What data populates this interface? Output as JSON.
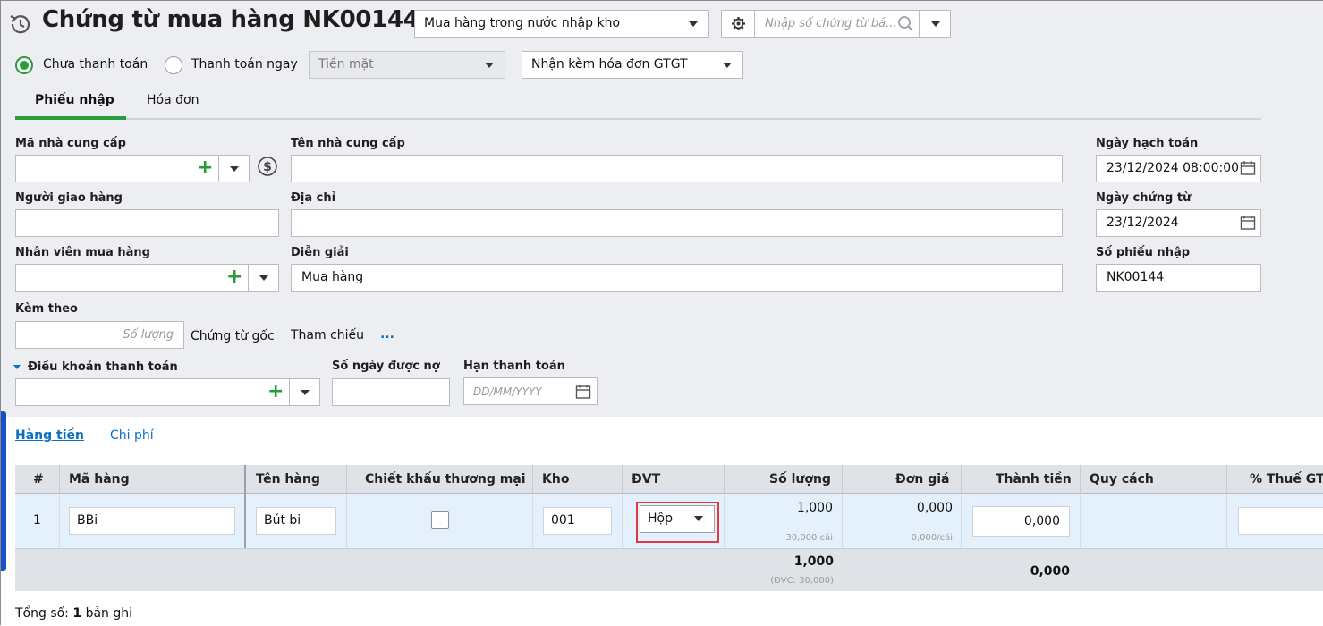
{
  "header": {
    "title": "Chứng từ mua hàng NK00144",
    "voucher_type": "Mua hàng trong nước nhập kho",
    "search_placeholder": "Nhập số chứng từ bá..."
  },
  "payment": {
    "unpaid_label": "Chưa thanh toán",
    "paid_now_label": "Thanh toán ngay",
    "method": "Tiền mặt",
    "invoice_option": "Nhận kèm hóa đơn GTGT"
  },
  "tabs": [
    "Phiếu nhập",
    "Hóa đơn"
  ],
  "form": {
    "supplier_code_label": "Mã nhà cung cấp",
    "supplier_name_label": "Tên nhà cung cấp",
    "deliverer_label": "Người giao hàng",
    "address_label": "Địa chỉ",
    "buyer_label": "Nhân viên mua hàng",
    "description_label": "Diễn giải",
    "description_value": "Mua hàng",
    "attach_label": "Kèm theo",
    "attach_placeholder": "Số lượng",
    "original_doc_label": "Chứng từ gốc",
    "reference_label": "Tham chiếu",
    "reference_more": "...",
    "payment_terms_label": "Điều khoản thanh toán",
    "debt_days_label": "Số ngày được nợ",
    "due_date_label": "Hạn thanh toán",
    "due_date_placeholder": "DD/MM/YYYY"
  },
  "right_panel": {
    "posting_date_label": "Ngày hạch toán",
    "posting_date_value": "23/12/2024 08:00:00",
    "voucher_date_label": "Ngày chứng từ",
    "voucher_date_value": "23/12/2024",
    "receipt_no_label": "Số phiếu nhập",
    "receipt_no_value": "NK00144"
  },
  "detail_tabs": [
    "Hàng tiền",
    "Chi phí"
  ],
  "grid": {
    "columns": [
      "#",
      "Mã hàng",
      "Tên hàng",
      "Chiết khấu thương mại",
      "Kho",
      "ĐVT",
      "Số lượng",
      "Đơn giá",
      "Thành tiền",
      "Quy cách",
      "% Thuế GTGT"
    ],
    "row": {
      "index": "1",
      "item_code": "BBi",
      "item_name": "Bút bi",
      "warehouse": "001",
      "unit": "Hộp",
      "quantity": "1,000",
      "quantity_sub": "30,000 cái",
      "unit_price": "0,000",
      "unit_price_sub": "0,000/cái",
      "amount": "0,000"
    },
    "totals": {
      "quantity": "1,000",
      "quantity_sub": "(ĐVC: 30,000)",
      "amount": "0,000"
    }
  },
  "footer": {
    "total_prefix": "Tổng số:",
    "total_count": "1",
    "total_suffix": "bản ghi"
  },
  "colors": {
    "accent_green": "#2a9d3b",
    "link_blue": "#0b6fc4",
    "highlight_red": "#e0393e",
    "row_bg": "#e4f0fb"
  }
}
